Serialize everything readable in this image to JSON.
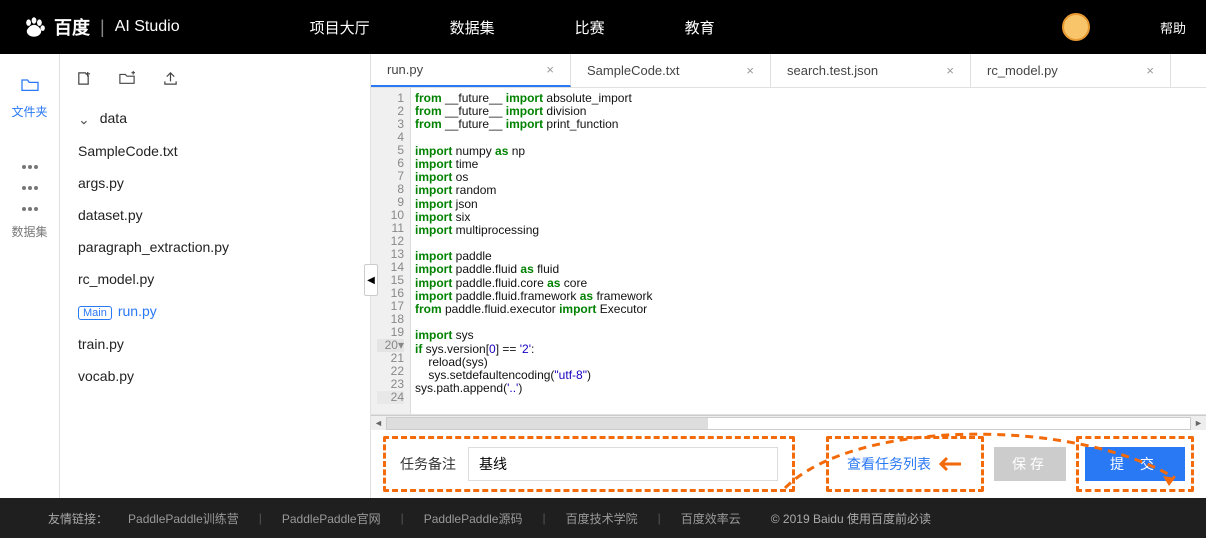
{
  "topbar": {
    "brand1": "百度",
    "brand2": "AI Studio",
    "nav": [
      "项目大厅",
      "数据集",
      "比赛",
      "教育"
    ],
    "help": "帮助"
  },
  "rail": {
    "files": "文件夹",
    "datasets": "数据集"
  },
  "tree": {
    "folder": "data",
    "files": [
      "SampleCode.txt",
      "args.py",
      "dataset.py",
      "paragraph_extraction.py",
      "rc_model.py"
    ],
    "main_badge": "Main",
    "main_file": "run.py",
    "files2": [
      "train.py",
      "vocab.py"
    ]
  },
  "tabs": [
    {
      "name": "run.py",
      "active": true
    },
    {
      "name": "SampleCode.txt",
      "active": false
    },
    {
      "name": "search.test.json",
      "active": false
    },
    {
      "name": "rc_model.py",
      "active": false
    }
  ],
  "code": {
    "lines": [
      {
        "n": 1,
        "seg": [
          [
            "kw",
            "from"
          ],
          [
            "",
            " __future__ "
          ],
          [
            "kw",
            "import"
          ],
          [
            "",
            " absolute_import"
          ]
        ]
      },
      {
        "n": 2,
        "seg": [
          [
            "kw",
            "from"
          ],
          [
            "",
            " __future__ "
          ],
          [
            "kw",
            "import"
          ],
          [
            "",
            " division"
          ]
        ]
      },
      {
        "n": 3,
        "seg": [
          [
            "kw",
            "from"
          ],
          [
            "",
            " __future__ "
          ],
          [
            "kw",
            "import"
          ],
          [
            "",
            " print_function"
          ]
        ]
      },
      {
        "n": 4,
        "seg": [
          [
            "",
            " "
          ]
        ]
      },
      {
        "n": 5,
        "seg": [
          [
            "kw",
            "import"
          ],
          [
            "",
            " numpy "
          ],
          [
            "kw",
            "as"
          ],
          [
            "",
            " np"
          ]
        ]
      },
      {
        "n": 6,
        "seg": [
          [
            "kw",
            "import"
          ],
          [
            "",
            " time"
          ]
        ]
      },
      {
        "n": 7,
        "seg": [
          [
            "kw",
            "import"
          ],
          [
            "",
            " os"
          ]
        ]
      },
      {
        "n": 8,
        "seg": [
          [
            "kw",
            "import"
          ],
          [
            "",
            " random"
          ]
        ]
      },
      {
        "n": 9,
        "seg": [
          [
            "kw",
            "import"
          ],
          [
            "",
            " json"
          ]
        ]
      },
      {
        "n": 10,
        "seg": [
          [
            "kw",
            "import"
          ],
          [
            "",
            " six"
          ]
        ]
      },
      {
        "n": 11,
        "seg": [
          [
            "kw",
            "import"
          ],
          [
            "",
            " multiprocessing"
          ]
        ]
      },
      {
        "n": 12,
        "seg": [
          [
            "",
            " "
          ]
        ]
      },
      {
        "n": 13,
        "seg": [
          [
            "kw",
            "import"
          ],
          [
            "",
            " paddle"
          ]
        ]
      },
      {
        "n": 14,
        "seg": [
          [
            "kw",
            "import"
          ],
          [
            "",
            " paddle.fluid "
          ],
          [
            "kw",
            "as"
          ],
          [
            "",
            " fluid"
          ]
        ]
      },
      {
        "n": 15,
        "seg": [
          [
            "kw",
            "import"
          ],
          [
            "",
            " paddle.fluid.core "
          ],
          [
            "kw",
            "as"
          ],
          [
            "",
            " core"
          ]
        ]
      },
      {
        "n": 16,
        "seg": [
          [
            "kw",
            "import"
          ],
          [
            "",
            " paddle.fluid.framework "
          ],
          [
            "kw",
            "as"
          ],
          [
            "",
            " framework"
          ]
        ]
      },
      {
        "n": 17,
        "seg": [
          [
            "kw",
            "from"
          ],
          [
            "",
            " paddle.fluid.executor "
          ],
          [
            "kw",
            "import"
          ],
          [
            "",
            " Executor"
          ]
        ]
      },
      {
        "n": 18,
        "seg": [
          [
            "",
            " "
          ]
        ]
      },
      {
        "n": 19,
        "seg": [
          [
            "kw",
            "import"
          ],
          [
            "",
            " sys"
          ]
        ]
      },
      {
        "n": "20▾",
        "seg": [
          [
            "kw",
            "if"
          ],
          [
            "",
            " sys.version["
          ],
          [
            "nm",
            "0"
          ],
          [
            "",
            "] == "
          ],
          [
            "st",
            "'2'"
          ],
          [
            "",
            ":"
          ]
        ]
      },
      {
        "n": 21,
        "seg": [
          [
            "",
            "    reload(sys)"
          ]
        ]
      },
      {
        "n": 22,
        "seg": [
          [
            "",
            "    sys.setdefaultencoding("
          ],
          [
            "st",
            "\"utf-8\""
          ],
          [
            "",
            ")"
          ]
        ]
      },
      {
        "n": 23,
        "seg": [
          [
            "",
            "sys.path.append("
          ],
          [
            "st",
            "'..'"
          ],
          [
            "",
            ")"
          ]
        ]
      },
      {
        "n": 24,
        "seg": [
          [
            "",
            ""
          ]
        ]
      }
    ]
  },
  "bottom": {
    "note_label": "任务备注",
    "note_value": "基线",
    "view_tasks": "查看任务列表",
    "save": "保存",
    "submit": "提 交"
  },
  "footer": {
    "label": "友情链接：",
    "links": [
      "PaddlePaddle训练营",
      "PaddlePaddle官网",
      "PaddlePaddle源码",
      "百度技术学院",
      "百度效率云"
    ],
    "copyright": "© 2019 Baidu 使用百度前必读"
  }
}
